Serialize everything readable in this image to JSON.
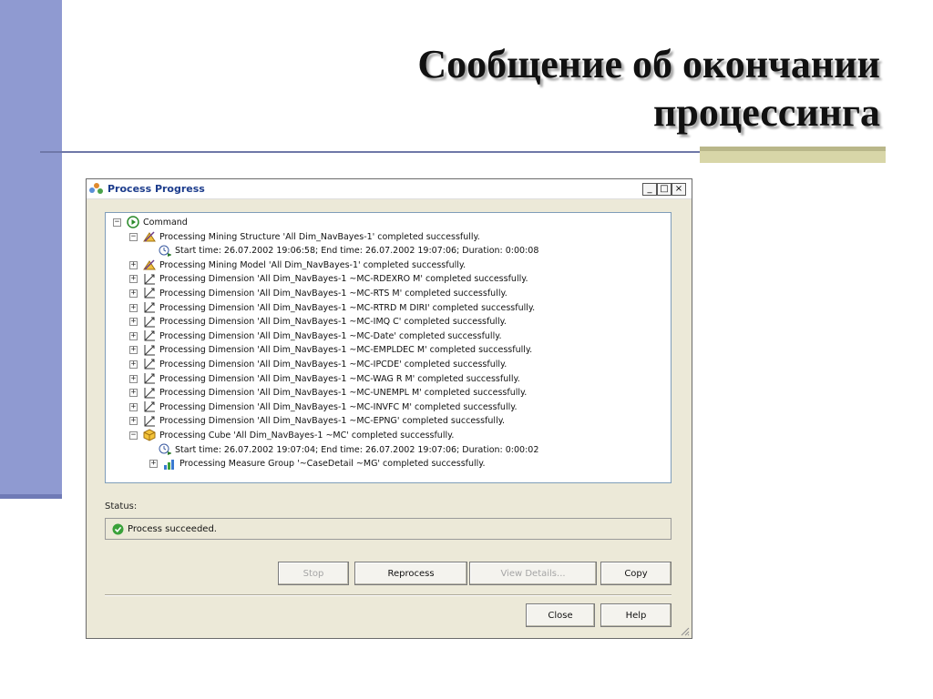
{
  "slide": {
    "title_line1": "Сообщение об окончании",
    "title_line2": "процессинга"
  },
  "window": {
    "title": "Process Progress",
    "controls": {
      "minimize": "_",
      "maximize": "□",
      "close": "×"
    }
  },
  "tree": {
    "root": "Command",
    "rows": [
      {
        "text": "Processing Mining Structure 'All Dim_NavBayes-1' completed successfully.",
        "toggle": "−",
        "icon": "mining-structure-icon"
      },
      {
        "text": "Start time: 26.07.2002 19:06:58; End time: 26.07.2002 19:07:06; Duration: 0:00:08",
        "toggle": "",
        "icon": "clock-icon"
      },
      {
        "text": "Processing Mining Model 'All Dim_NavBayes-1' completed successfully.",
        "toggle": "+",
        "icon": "mining-model-icon"
      },
      {
        "text": "Processing Dimension 'All Dim_NavBayes-1 ~MC-RDEXRO M' completed successfully.",
        "toggle": "+",
        "icon": "dimension-icon"
      },
      {
        "text": "Processing Dimension 'All Dim_NavBayes-1 ~MC-RTS M' completed successfully.",
        "toggle": "+",
        "icon": "dimension-icon"
      },
      {
        "text": "Processing Dimension 'All Dim_NavBayes-1 ~MC-RTRD M DIRI' completed successfully.",
        "toggle": "+",
        "icon": "dimension-icon"
      },
      {
        "text": "Processing Dimension 'All Dim_NavBayes-1 ~MC-IMQ C' completed successfully.",
        "toggle": "+",
        "icon": "dimension-icon"
      },
      {
        "text": "Processing Dimension 'All Dim_NavBayes-1 ~MC-Date' completed successfully.",
        "toggle": "+",
        "icon": "dimension-icon"
      },
      {
        "text": "Processing Dimension 'All Dim_NavBayes-1 ~MC-EMPLDEC M' completed successfully.",
        "toggle": "+",
        "icon": "dimension-icon"
      },
      {
        "text": "Processing Dimension 'All Dim_NavBayes-1 ~MC-IPCDE' completed successfully.",
        "toggle": "+",
        "icon": "dimension-icon"
      },
      {
        "text": "Processing Dimension 'All Dim_NavBayes-1 ~MC-WAG R M' completed successfully.",
        "toggle": "+",
        "icon": "dimension-icon"
      },
      {
        "text": "Processing Dimension 'All Dim_NavBayes-1 ~MC-UNEMPL M' completed successfully.",
        "toggle": "+",
        "icon": "dimension-icon"
      },
      {
        "text": "Processing Dimension 'All Dim_NavBayes-1 ~MC-INVFC M' completed successfully.",
        "toggle": "+",
        "icon": "dimension-icon"
      },
      {
        "text": "Processing Dimension 'All Dim_NavBayes-1 ~MC-EPNG' completed successfully.",
        "toggle": "+",
        "icon": "dimension-icon"
      },
      {
        "text": "Processing Cube 'All Dim_NavBayes-1 ~MC' completed successfully.",
        "toggle": "−",
        "icon": "cube-icon"
      },
      {
        "text": "Start time: 26.07.2002 19:07:04; End time: 26.07.2002 19:07:06; Duration: 0:00:02",
        "toggle": "",
        "icon": "clock-icon"
      },
      {
        "text": "Processing Measure Group '~CaseDetail ~MG' completed successfully.",
        "toggle": "+",
        "icon": "measure-group-icon"
      }
    ]
  },
  "status": {
    "label": "Status:",
    "text": "Process succeeded."
  },
  "buttons": {
    "stop": "Stop",
    "reprocess": "Reprocess",
    "view_details": "View Details...",
    "copy": "Copy",
    "close": "Close",
    "help": "Help"
  },
  "colors": {
    "slide_bar": "#8f9ad1",
    "accent": "#d8d6a8",
    "window_bg": "#ece9d8",
    "title_text": "#1c3c8c"
  }
}
